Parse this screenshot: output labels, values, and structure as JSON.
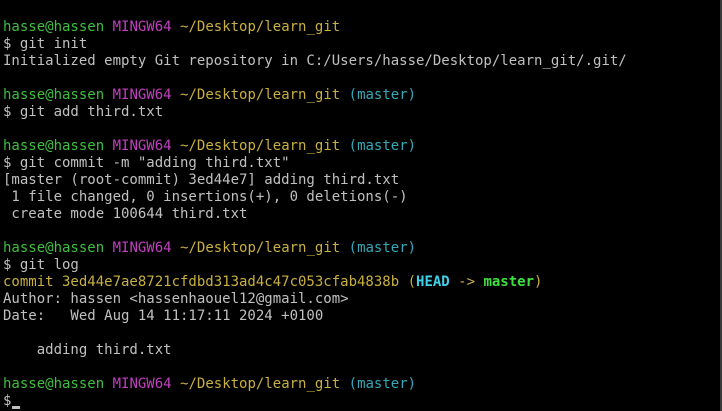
{
  "colors": {
    "background": "#000000",
    "text": "#c0c0c0",
    "user_host": "#3ebe3e",
    "mingw": "#c040c0",
    "path": "#c8b040",
    "branch": "#35a8b8",
    "commit_hash": "#c8b040",
    "head": "#40d0e8",
    "master_bold": "#40e040"
  },
  "lines": [
    {
      "segs": [
        {
          "text": "hasse@hassen",
          "style": "user_host"
        },
        {
          "text": " ",
          "style": "text"
        },
        {
          "text": "MINGW64",
          "style": "mingw"
        },
        {
          "text": " ",
          "style": "text"
        },
        {
          "text": "~/Desktop/learn_git",
          "style": "path"
        }
      ]
    },
    {
      "segs": [
        {
          "text": "$ git init",
          "style": "text"
        }
      ]
    },
    {
      "segs": [
        {
          "text": "Initialized empty Git repository in C:/Users/hasse/Desktop/learn_git/.git/",
          "style": "text"
        }
      ]
    },
    {
      "segs": [
        {
          "text": "",
          "style": "text"
        }
      ]
    },
    {
      "segs": [
        {
          "text": "hasse@hassen",
          "style": "user_host"
        },
        {
          "text": " ",
          "style": "text"
        },
        {
          "text": "MINGW64",
          "style": "mingw"
        },
        {
          "text": " ",
          "style": "text"
        },
        {
          "text": "~/Desktop/learn_git",
          "style": "path"
        },
        {
          "text": " ",
          "style": "text"
        },
        {
          "text": "(master)",
          "style": "branch"
        }
      ]
    },
    {
      "segs": [
        {
          "text": "$ git add third.txt",
          "style": "text"
        }
      ]
    },
    {
      "segs": [
        {
          "text": "",
          "style": "text"
        }
      ]
    },
    {
      "segs": [
        {
          "text": "hasse@hassen",
          "style": "user_host"
        },
        {
          "text": " ",
          "style": "text"
        },
        {
          "text": "MINGW64",
          "style": "mingw"
        },
        {
          "text": " ",
          "style": "text"
        },
        {
          "text": "~/Desktop/learn_git",
          "style": "path"
        },
        {
          "text": " ",
          "style": "text"
        },
        {
          "text": "(master)",
          "style": "branch"
        }
      ]
    },
    {
      "segs": [
        {
          "text": "$ git commit -m \"adding third.txt\"",
          "style": "text"
        }
      ]
    },
    {
      "segs": [
        {
          "text": "[master (root-commit) 3ed44e7] adding third.txt",
          "style": "text"
        }
      ]
    },
    {
      "segs": [
        {
          "text": " 1 file changed, 0 insertions(+), 0 deletions(-)",
          "style": "text"
        }
      ]
    },
    {
      "segs": [
        {
          "text": " create mode 100644 third.txt",
          "style": "text"
        }
      ]
    },
    {
      "segs": [
        {
          "text": "",
          "style": "text"
        }
      ]
    },
    {
      "segs": [
        {
          "text": "hasse@hassen",
          "style": "user_host"
        },
        {
          "text": " ",
          "style": "text"
        },
        {
          "text": "MINGW64",
          "style": "mingw"
        },
        {
          "text": " ",
          "style": "text"
        },
        {
          "text": "~/Desktop/learn_git",
          "style": "path"
        },
        {
          "text": " ",
          "style": "text"
        },
        {
          "text": "(master)",
          "style": "branch"
        }
      ]
    },
    {
      "segs": [
        {
          "text": "$ git log",
          "style": "text"
        }
      ]
    },
    {
      "segs": [
        {
          "text": "commit 3ed44e7ae8721cfdbd313ad4c47c053cfab4838b",
          "style": "commit_hash"
        },
        {
          "text": " (",
          "style": "commit_hash"
        },
        {
          "text": "HEAD",
          "style": "head",
          "bold": true
        },
        {
          "text": " -> ",
          "style": "commit_hash"
        },
        {
          "text": "master",
          "style": "master_bold",
          "bold": true
        },
        {
          "text": ")",
          "style": "commit_hash"
        }
      ]
    },
    {
      "segs": [
        {
          "text": "Author: hassen <hassenhaouel12@gmail.com>",
          "style": "text"
        }
      ]
    },
    {
      "segs": [
        {
          "text": "Date:   Wed Aug 14 11:17:11 2024 +0100",
          "style": "text"
        }
      ]
    },
    {
      "segs": [
        {
          "text": "",
          "style": "text"
        }
      ]
    },
    {
      "segs": [
        {
          "text": "    adding third.txt",
          "style": "text"
        }
      ]
    },
    {
      "segs": [
        {
          "text": "",
          "style": "text"
        }
      ]
    },
    {
      "segs": [
        {
          "text": "hasse@hassen",
          "style": "user_host"
        },
        {
          "text": " ",
          "style": "text"
        },
        {
          "text": "MINGW64",
          "style": "mingw"
        },
        {
          "text": " ",
          "style": "text"
        },
        {
          "text": "~/Desktop/learn_git",
          "style": "path"
        },
        {
          "text": " ",
          "style": "text"
        },
        {
          "text": "(master)",
          "style": "branch"
        }
      ]
    },
    {
      "segs": [
        {
          "text": "$",
          "style": "text"
        }
      ],
      "cursor": true
    }
  ]
}
